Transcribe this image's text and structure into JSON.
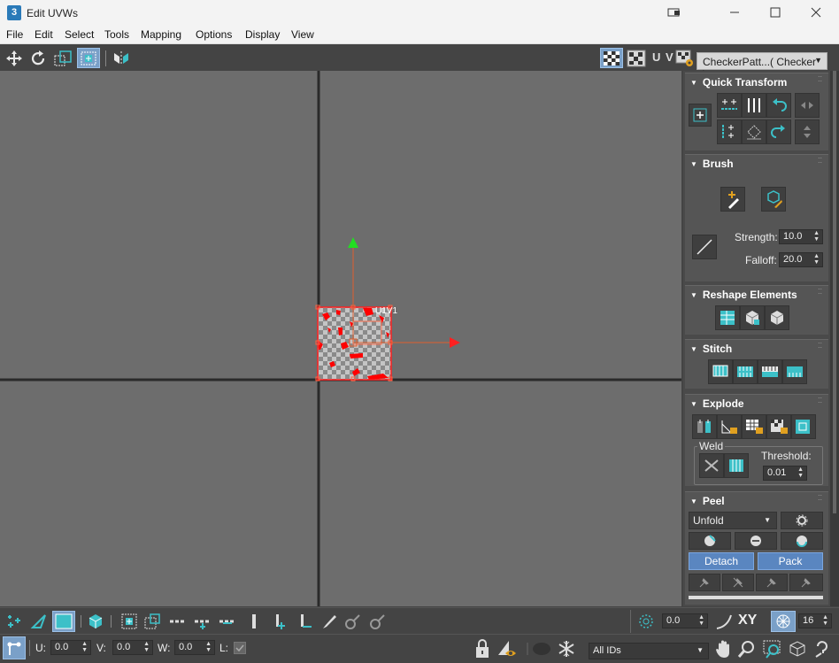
{
  "window": {
    "title": "Edit UVWs",
    "app_icon": "3",
    "icons": [
      "restore-icon",
      "minimize-icon",
      "maximize-icon",
      "close-icon"
    ]
  },
  "menu": [
    "File",
    "Edit",
    "Select",
    "Tools",
    "Mapping",
    "Options",
    "Display",
    "View"
  ],
  "toolbar": {
    "uv_label": "U V",
    "checker_dropdown": "CheckerPatt...( Checker )"
  },
  "viewport": {
    "uv_label": "U1V1",
    "colors": {
      "gizmo_x": "#ff2a2a",
      "gizmo_y": "#22dd22",
      "axis_line": "#e06030",
      "selection": "#ff0000"
    }
  },
  "panel": {
    "quick_transform": {
      "title": "Quick Transform"
    },
    "brush": {
      "title": "Brush",
      "strength_label": "Strength:",
      "strength_value": "10.0",
      "falloff_label": "Falloff:",
      "falloff_value": "20.0"
    },
    "reshape": {
      "title": "Reshape Elements"
    },
    "stitch": {
      "title": "Stitch"
    },
    "explode": {
      "title": "Explode",
      "weld_label": "Weld",
      "threshold_label": "Threshold:",
      "threshold_value": "0.01"
    },
    "peel": {
      "title": "Peel",
      "unfold_label": "Unfold",
      "detach_label": "Detach",
      "pack_label": "Pack"
    }
  },
  "bottom": {
    "xy_label": "XY",
    "angle_value": "0.0",
    "grid_value": "16",
    "u_label": "U:",
    "u_value": "0.0",
    "v_label": "V:",
    "v_value": "0.0",
    "w_label": "W:",
    "w_value": "0.0",
    "l_label": "L:",
    "ids_value": "All IDs"
  },
  "accent": "#3cc0c8"
}
